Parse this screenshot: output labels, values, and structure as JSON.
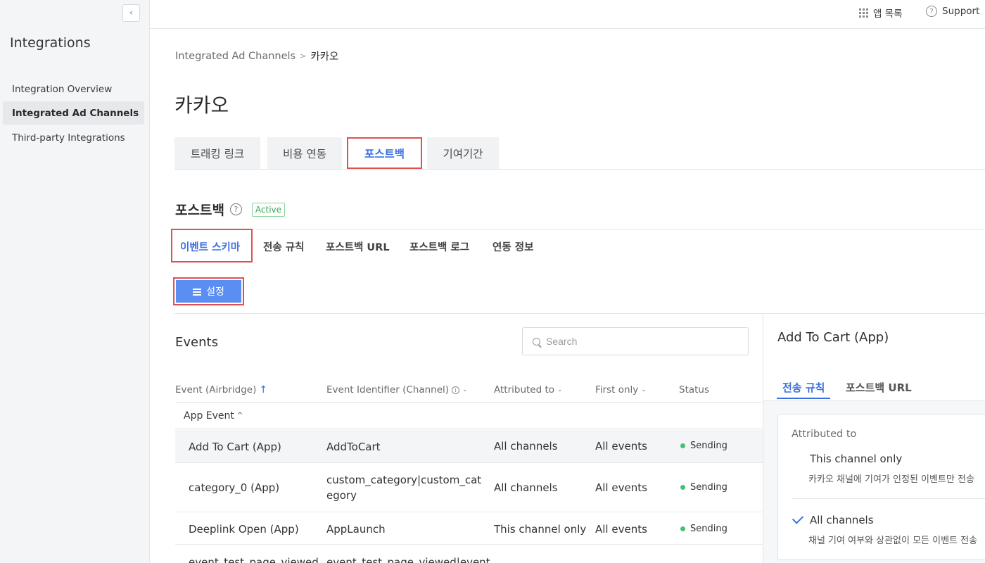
{
  "sidebar": {
    "title": "Integrations",
    "items": [
      {
        "label": "Integration Overview"
      },
      {
        "label": "Integrated Ad Channels"
      },
      {
        "label": "Third-party Integrations"
      }
    ]
  },
  "topbar": {
    "apps_label": "앱 목록",
    "support_label": "Support"
  },
  "breadcrumb": {
    "parent": "Integrated Ad Channels",
    "current": "카카오"
  },
  "page_title": "카카오",
  "main_tabs": [
    {
      "label": "트래킹 링크"
    },
    {
      "label": "비용 연동"
    },
    {
      "label": "포스트백"
    },
    {
      "label": "기여기간"
    }
  ],
  "section": {
    "title": "포스트백",
    "badge": "Active"
  },
  "sub_tabs": [
    {
      "label": "이벤트 스키마"
    },
    {
      "label": "전송 규칙"
    },
    {
      "label": "포스트백 URL"
    },
    {
      "label": "포스트백 로그"
    },
    {
      "label": "연동 정보"
    }
  ],
  "setup_button": "설정",
  "events": {
    "title": "Events",
    "search_placeholder": "Search",
    "columns": {
      "event": "Event (Airbridge)",
      "identifier": "Event Identifier (Channel)",
      "attributed": "Attributed to",
      "first_only": "First only",
      "status": "Status"
    },
    "group": "App Event",
    "rows": [
      {
        "event": "Add To Cart (App)",
        "identifier": "AddToCart",
        "attributed": "All channels",
        "first_only": "All events",
        "status": "Sending"
      },
      {
        "event": "category_0 (App)",
        "identifier": "custom_category|custom_category",
        "attributed": "All channels",
        "first_only": "All events",
        "status": "Sending"
      },
      {
        "event": "Deeplink Open (App)",
        "identifier": "AppLaunch",
        "attributed": "This channel only",
        "first_only": "All events",
        "status": "Sending"
      },
      {
        "event": "event_test_page_viewed",
        "identifier": "event_test_page_viewed|event",
        "attributed": "",
        "first_only": "",
        "status": ""
      }
    ]
  },
  "detail": {
    "title": "Add To Cart (App)",
    "tabs": [
      {
        "label": "전송 규칙"
      },
      {
        "label": "포스트백 URL"
      }
    ],
    "card_label": "Attributed to",
    "options": [
      {
        "title": "This channel only",
        "desc": "카카오 채널에 기여가 인정된 이벤트만 전송"
      },
      {
        "title": "All channels",
        "desc": "채널 기여 여부와 상관없이 모든 이벤트 전송"
      }
    ]
  },
  "colors": {
    "accent": "#3b6fe0",
    "highlight": "#e05050",
    "button": "#5b8ef2",
    "status_green": "#44c26d"
  }
}
